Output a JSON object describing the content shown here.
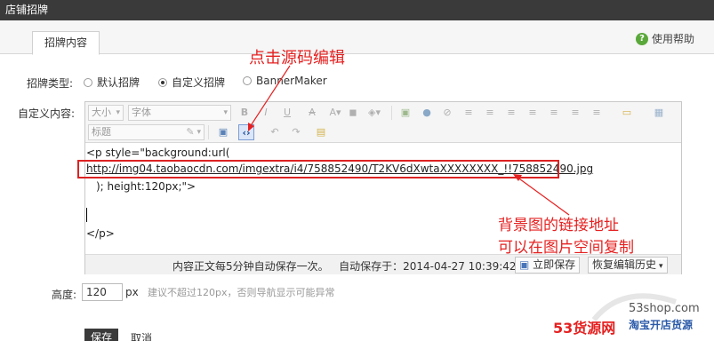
{
  "window": {
    "title": "店铺招牌"
  },
  "tabs": [
    {
      "label": "招牌内容"
    }
  ],
  "help": {
    "label": "使用帮助"
  },
  "annotations": {
    "top": "点击源码编辑",
    "right_line1": "背景图的链接地址",
    "right_line2": "可以在图片空间复制"
  },
  "form": {
    "type_label": "招牌类型:",
    "type_options": [
      {
        "label": "默认招牌",
        "selected": false
      },
      {
        "label": "自定义招牌",
        "selected": true
      },
      {
        "label": "BannerMaker",
        "selected": false
      }
    ],
    "content_label": "自定义内容:",
    "height_label": "高度:",
    "height_value": "120",
    "height_unit": "px",
    "height_hint": "建议不超过120px，否则导航显示可能异常"
  },
  "toolbar": {
    "size_select": "大小",
    "font_select": "字体",
    "heading_select": "标题",
    "bold": "B",
    "italic": "I",
    "underline": "U",
    "strike": "A",
    "source_icon": "source-code-icon"
  },
  "code": {
    "line1": "<p style=\"background:url(",
    "line2": "http://img04.taobaocdn.com/imgextra/i4/758852490/T2KV6dXwtaXXXXXXXX_!!758852490.jpg",
    "line3": "); height:120px;\">",
    "line4": "</p>"
  },
  "status": {
    "autosave_note": "内容正文每5分钟自动保存一次。",
    "autosave_time": "自动保存于：2014-04-27 10:39:42",
    "save_now": "立即保存",
    "restore_history": "恢复编辑历史"
  },
  "actions": {
    "save": "保存",
    "cancel": "取消"
  },
  "watermark": {
    "logo_num": "53",
    "logo_text": "货源网",
    "domain": "53shop.com",
    "slogan": "淘宝开店货源"
  },
  "colors": {
    "annotation": "#e52020",
    "titlebar": "#3a3a3a",
    "help": "#5aa83a"
  }
}
